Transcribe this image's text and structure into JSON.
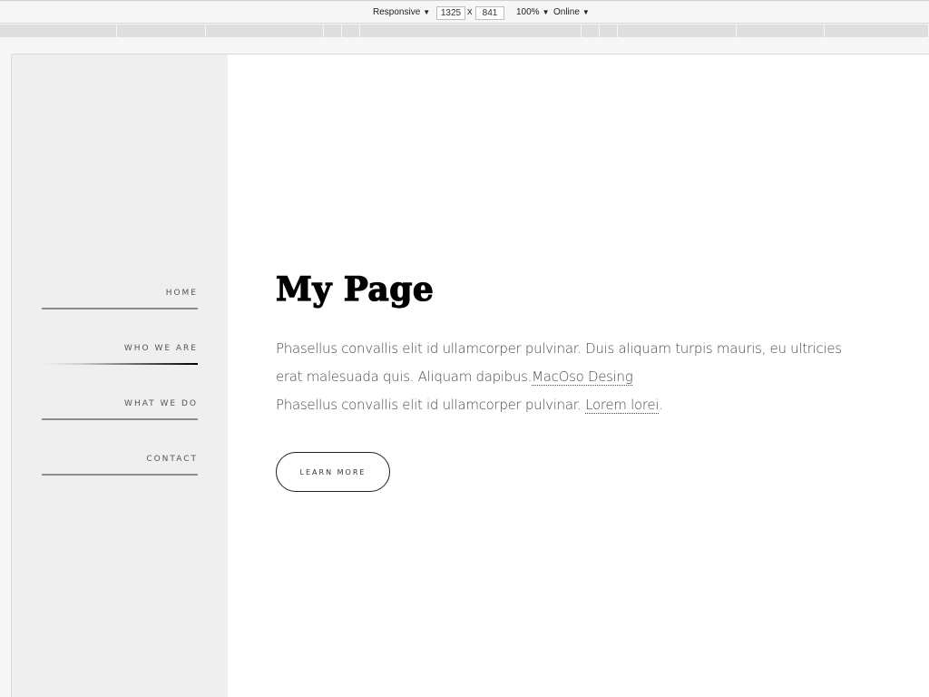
{
  "devtools": {
    "device": "Responsive",
    "width": "1325",
    "times": "x",
    "height": "841",
    "zoom": "100%",
    "network": "Online"
  },
  "nav": {
    "items": [
      {
        "label": "HOME"
      },
      {
        "label": "WHO WE ARE",
        "active": true
      },
      {
        "label": "WHAT WE DO"
      },
      {
        "label": "CONTACT"
      }
    ]
  },
  "main": {
    "title": "My Page",
    "para_line1": "Phasellus convallis elit id ullamcorper pulvinar. Duis aliquam turpis mauris, eu ultricies erat malesuada quis. Aliquam dapibus.",
    "link1": "MacOso Desing",
    "para_line2": "Phasellus convallis elit id ullamcorper pulvinar. ",
    "link2": "Lorem lorei",
    "para_end": ".",
    "button": "LEARN MORE"
  }
}
